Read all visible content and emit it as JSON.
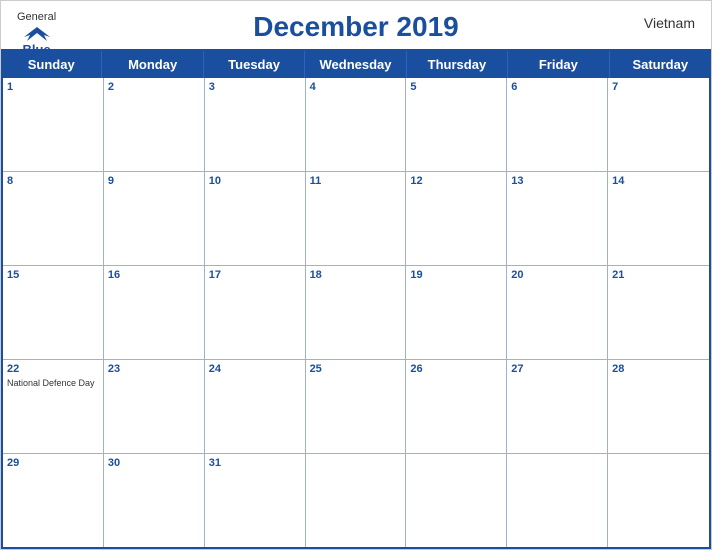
{
  "header": {
    "title": "December 2019",
    "country": "Vietnam",
    "logo": {
      "general": "General",
      "blue": "Blue"
    }
  },
  "days": {
    "headers": [
      "Sunday",
      "Monday",
      "Tuesday",
      "Wednesday",
      "Thursday",
      "Friday",
      "Saturday"
    ]
  },
  "weeks": [
    [
      {
        "num": "1",
        "holiday": ""
      },
      {
        "num": "2",
        "holiday": ""
      },
      {
        "num": "3",
        "holiday": ""
      },
      {
        "num": "4",
        "holiday": ""
      },
      {
        "num": "5",
        "holiday": ""
      },
      {
        "num": "6",
        "holiday": ""
      },
      {
        "num": "7",
        "holiday": ""
      }
    ],
    [
      {
        "num": "8",
        "holiday": ""
      },
      {
        "num": "9",
        "holiday": ""
      },
      {
        "num": "10",
        "holiday": ""
      },
      {
        "num": "11",
        "holiday": ""
      },
      {
        "num": "12",
        "holiday": ""
      },
      {
        "num": "13",
        "holiday": ""
      },
      {
        "num": "14",
        "holiday": ""
      }
    ],
    [
      {
        "num": "15",
        "holiday": ""
      },
      {
        "num": "16",
        "holiday": ""
      },
      {
        "num": "17",
        "holiday": ""
      },
      {
        "num": "18",
        "holiday": ""
      },
      {
        "num": "19",
        "holiday": ""
      },
      {
        "num": "20",
        "holiday": ""
      },
      {
        "num": "21",
        "holiday": ""
      }
    ],
    [
      {
        "num": "22",
        "holiday": "National Defence Day"
      },
      {
        "num": "23",
        "holiday": ""
      },
      {
        "num": "24",
        "holiday": ""
      },
      {
        "num": "25",
        "holiday": ""
      },
      {
        "num": "26",
        "holiday": ""
      },
      {
        "num": "27",
        "holiday": ""
      },
      {
        "num": "28",
        "holiday": ""
      }
    ],
    [
      {
        "num": "29",
        "holiday": ""
      },
      {
        "num": "30",
        "holiday": ""
      },
      {
        "num": "31",
        "holiday": ""
      },
      {
        "num": "",
        "holiday": ""
      },
      {
        "num": "",
        "holiday": ""
      },
      {
        "num": "",
        "holiday": ""
      },
      {
        "num": "",
        "holiday": ""
      }
    ]
  ],
  "colors": {
    "primary": "#1a4fa0",
    "header_bg": "#1a4fa0",
    "header_text": "#ffffff",
    "border": "#a0b0d0"
  }
}
